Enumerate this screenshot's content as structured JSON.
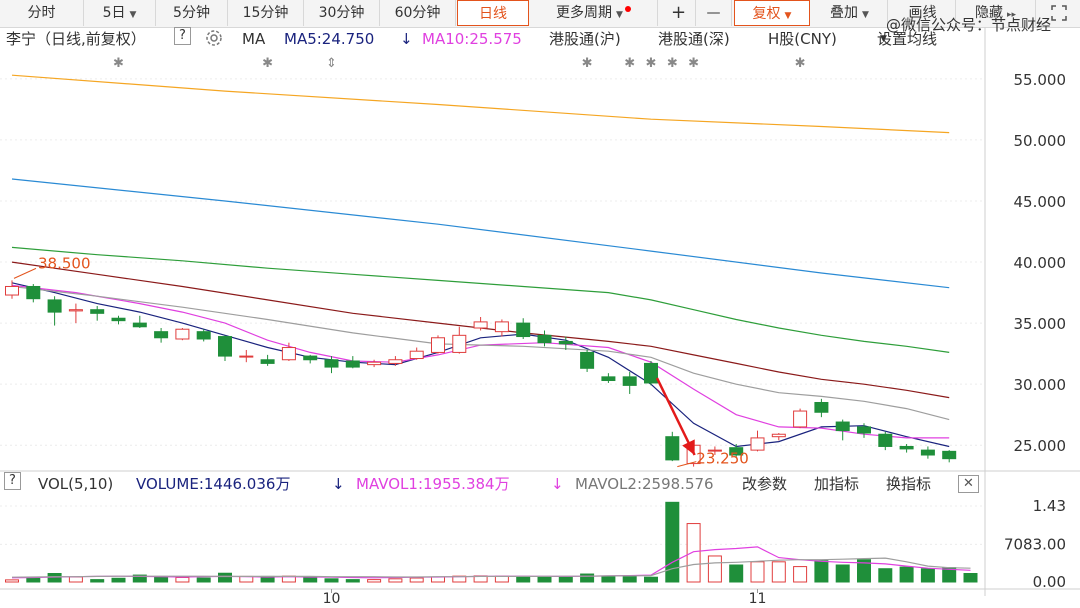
{
  "toolbar": {
    "items": [
      "分时",
      "5日",
      "5分钟",
      "15分钟",
      "30分钟",
      "60分钟",
      "日线",
      "更多周期",
      "+",
      "—",
      "复权",
      "叠加",
      "画线",
      "隐藏"
    ],
    "active": "日线"
  },
  "watermark": "@微信公众号：节点财经",
  "legend": {
    "name": "李宁（日线,前复权）",
    "help": "?",
    "ma_label": "MA",
    "ma5": "MA5:24.750",
    "ma5_arrow": "↓",
    "ma10": "MA10:25.575",
    "hk1": "港股通(沪)",
    "hk2": "港股通(深)",
    "hshare": "H股(CNY)",
    "settings": "设置均线"
  },
  "volume_legend": {
    "help": "?",
    "vol": "VOL(5,10)",
    "volume": "VOLUME:1446.036万",
    "volume_arrow": "↓",
    "mavol1": "MAVOL1:1955.384万",
    "mavol1_arrow": "↓",
    "mavol2": "MAVOL2:2598.576",
    "change_params": "改参数",
    "add_indicator": "加指标",
    "switch_indicator": "换指标",
    "close": "✕"
  },
  "colors": {
    "up": "#e03c3c",
    "down": "#1f8f3a",
    "ma5": "#1a237e",
    "ma10": "#e040e0",
    "ma20": "#9e9e9e",
    "ma30": "#8b1a1a",
    "ma60": "#2e9e3a",
    "ma120": "#2a8ad4",
    "ma250": "#f5a623",
    "highlight": "#e3541d",
    "arrow": "#e31a1a"
  },
  "chart_data": {
    "type": "candlestick",
    "y_axis": {
      "ticks": [
        25,
        30,
        35,
        40,
        45,
        50,
        55
      ],
      "tick_labels": [
        "25.000",
        "30.000",
        "35.000",
        "40.000",
        "45.000",
        "50.000",
        "55.000"
      ],
      "range": [
        23.3,
        57.2
      ]
    },
    "x_axis": {
      "labels": [
        {
          "text": "10",
          "index": 15
        },
        {
          "text": "11",
          "index": 35
        }
      ]
    },
    "annotations": [
      {
        "text": "38.500",
        "index": 0,
        "value": 38.5
      },
      {
        "text": "23.250",
        "index": 31,
        "value": 23.25
      }
    ],
    "event_markers": [
      {
        "index": 5,
        "symbol": "✱"
      },
      {
        "index": 12,
        "symbol": "✱"
      },
      {
        "index": 15,
        "symbol": "⇕"
      },
      {
        "index": 27,
        "symbol": "✱"
      },
      {
        "index": 29,
        "symbol": "✱"
      },
      {
        "index": 30,
        "symbol": "✱"
      },
      {
        "index": 31,
        "symbol": "✱"
      },
      {
        "index": 32,
        "symbol": "✱"
      },
      {
        "index": 37,
        "symbol": "✱"
      }
    ],
    "candles": [
      {
        "o": 37.3,
        "h": 38.5,
        "c": 38.0,
        "l": 37.0
      },
      {
        "o": 38.0,
        "h": 38.2,
        "c": 37.0,
        "l": 36.7
      },
      {
        "o": 36.9,
        "h": 37.2,
        "c": 35.9,
        "l": 34.8
      },
      {
        "o": 36.0,
        "h": 36.6,
        "c": 36.1,
        "l": 35.0
      },
      {
        "o": 36.1,
        "h": 36.4,
        "c": 35.8,
        "l": 35.2
      },
      {
        "o": 35.4,
        "h": 35.6,
        "c": 35.2,
        "l": 34.9
      },
      {
        "o": 35.0,
        "h": 35.6,
        "c": 34.7,
        "l": 34.6
      },
      {
        "o": 34.3,
        "h": 34.6,
        "c": 33.8,
        "l": 33.4
      },
      {
        "o": 33.7,
        "h": 34.6,
        "c": 34.5,
        "l": 33.6
      },
      {
        "o": 34.3,
        "h": 34.5,
        "c": 33.7,
        "l": 33.5
      },
      {
        "o": 33.9,
        "h": 34.0,
        "c": 32.3,
        "l": 31.9
      },
      {
        "o": 32.3,
        "h": 32.8,
        "c": 32.3,
        "l": 31.8
      },
      {
        "o": 32.0,
        "h": 32.4,
        "c": 31.7,
        "l": 31.5
      },
      {
        "o": 32.0,
        "h": 33.4,
        "c": 33.0,
        "l": 31.9
      },
      {
        "o": 32.3,
        "h": 32.4,
        "c": 32.0,
        "l": 31.7
      },
      {
        "o": 32.0,
        "h": 32.3,
        "c": 31.4,
        "l": 30.9
      },
      {
        "o": 31.9,
        "h": 32.3,
        "c": 31.4,
        "l": 31.3
      },
      {
        "o": 31.6,
        "h": 32.0,
        "c": 31.8,
        "l": 31.4
      },
      {
        "o": 31.7,
        "h": 32.3,
        "c": 32.0,
        "l": 31.5
      },
      {
        "o": 32.1,
        "h": 33.0,
        "c": 32.7,
        "l": 32.0
      },
      {
        "o": 32.6,
        "h": 34.0,
        "c": 33.8,
        "l": 32.5
      },
      {
        "o": 32.6,
        "h": 34.7,
        "c": 34.0,
        "l": 32.5
      },
      {
        "o": 34.6,
        "h": 35.5,
        "c": 35.1,
        "l": 34.4
      },
      {
        "o": 34.3,
        "h": 35.3,
        "c": 35.1,
        "l": 33.9
      },
      {
        "o": 35.0,
        "h": 35.4,
        "c": 33.9,
        "l": 33.7
      },
      {
        "o": 34.0,
        "h": 34.4,
        "c": 33.4,
        "l": 33.1
      },
      {
        "o": 33.5,
        "h": 33.9,
        "c": 33.3,
        "l": 32.8
      },
      {
        "o": 32.6,
        "h": 32.8,
        "c": 31.3,
        "l": 31.0
      },
      {
        "o": 30.6,
        "h": 30.9,
        "c": 30.3,
        "l": 30.1
      },
      {
        "o": 30.6,
        "h": 31.0,
        "c": 29.9,
        "l": 29.2
      },
      {
        "o": 31.7,
        "h": 31.9,
        "c": 30.1,
        "l": 29.9
      },
      {
        "o": 25.7,
        "h": 26.1,
        "c": 23.8,
        "l": 23.7
      },
      {
        "o": 23.5,
        "h": 25.1,
        "c": 25.0,
        "l": 23.25
      },
      {
        "o": 24.6,
        "h": 24.9,
        "c": 24.6,
        "l": 24.2
      },
      {
        "o": 24.8,
        "h": 25.1,
        "c": 24.2,
        "l": 24.0
      },
      {
        "o": 24.6,
        "h": 26.2,
        "c": 25.6,
        "l": 24.5
      },
      {
        "o": 25.7,
        "h": 26.0,
        "c": 25.9,
        "l": 25.4
      },
      {
        "o": 26.5,
        "h": 28.0,
        "c": 27.8,
        "l": 26.4
      },
      {
        "o": 28.5,
        "h": 28.8,
        "c": 27.7,
        "l": 27.3
      },
      {
        "o": 26.9,
        "h": 27.1,
        "c": 26.2,
        "l": 25.4
      },
      {
        "o": 26.5,
        "h": 26.8,
        "c": 26.0,
        "l": 25.6
      },
      {
        "o": 25.9,
        "h": 26.1,
        "c": 24.9,
        "l": 24.6
      },
      {
        "o": 24.9,
        "h": 25.1,
        "c": 24.7,
        "l": 24.4
      },
      {
        "o": 24.6,
        "h": 24.9,
        "c": 24.2,
        "l": 23.9
      },
      {
        "o": 24.5,
        "h": 24.6,
        "c": 23.9,
        "l": 23.6
      }
    ],
    "moving_averages": [
      {
        "name": "MA5",
        "points": [
          [
            0,
            38.3
          ],
          [
            2,
            37.5
          ],
          [
            4,
            36.6
          ],
          [
            6,
            35.9
          ],
          [
            8,
            35.0
          ],
          [
            10,
            34.0
          ],
          [
            12,
            33.0
          ],
          [
            14,
            32.2
          ],
          [
            16,
            31.8
          ],
          [
            18,
            31.6
          ],
          [
            20,
            32.6
          ],
          [
            22,
            33.8
          ],
          [
            24,
            34.1
          ],
          [
            26,
            33.6
          ],
          [
            28,
            32.2
          ],
          [
            30,
            30.0
          ],
          [
            32,
            26.8
          ],
          [
            34,
            24.9
          ],
          [
            36,
            25.3
          ],
          [
            38,
            26.5
          ],
          [
            40,
            26.6
          ],
          [
            42,
            25.7
          ],
          [
            44,
            24.9
          ]
        ]
      },
      {
        "name": "MA10",
        "points": [
          [
            0,
            38.1
          ],
          [
            3,
            37.5
          ],
          [
            6,
            36.6
          ],
          [
            8,
            35.9
          ],
          [
            10,
            35.0
          ],
          [
            12,
            33.6
          ],
          [
            14,
            32.6
          ],
          [
            16,
            31.9
          ],
          [
            18,
            31.8
          ],
          [
            20,
            32.4
          ],
          [
            22,
            33.2
          ],
          [
            25,
            33.4
          ],
          [
            28,
            33.0
          ],
          [
            30,
            31.8
          ],
          [
            32,
            29.6
          ],
          [
            34,
            27.5
          ],
          [
            36,
            26.5
          ],
          [
            38,
            26.4
          ],
          [
            40,
            25.9
          ],
          [
            42,
            25.6
          ],
          [
            44,
            25.6
          ]
        ]
      },
      {
        "name": "MA20",
        "points": [
          [
            0,
            38.0
          ],
          [
            4,
            37.2
          ],
          [
            8,
            36.3
          ],
          [
            12,
            35.3
          ],
          [
            16,
            34.2
          ],
          [
            20,
            33.3
          ],
          [
            24,
            33.1
          ],
          [
            28,
            32.7
          ],
          [
            30,
            32.2
          ],
          [
            32,
            30.9
          ],
          [
            34,
            30.0
          ],
          [
            36,
            29.3
          ],
          [
            38,
            29.0
          ],
          [
            40,
            28.6
          ],
          [
            42,
            28.0
          ],
          [
            44,
            27.1
          ]
        ]
      },
      {
        "name": "MA30",
        "points": [
          [
            0,
            40.0
          ],
          [
            4,
            39.0
          ],
          [
            8,
            38.0
          ],
          [
            12,
            36.9
          ],
          [
            16,
            35.8
          ],
          [
            20,
            35.0
          ],
          [
            24,
            34.2
          ],
          [
            28,
            33.5
          ],
          [
            30,
            33.1
          ],
          [
            32,
            32.4
          ],
          [
            34,
            31.7
          ],
          [
            36,
            31.0
          ],
          [
            38,
            30.4
          ],
          [
            40,
            30.0
          ],
          [
            42,
            29.5
          ],
          [
            44,
            28.9
          ]
        ]
      },
      {
        "name": "MA60",
        "points": [
          [
            0,
            41.2
          ],
          [
            4,
            40.6
          ],
          [
            8,
            40.1
          ],
          [
            12,
            39.5
          ],
          [
            16,
            39.0
          ],
          [
            20,
            38.5
          ],
          [
            24,
            38.0
          ],
          [
            28,
            37.5
          ],
          [
            30,
            36.9
          ],
          [
            32,
            36.1
          ],
          [
            34,
            35.3
          ],
          [
            36,
            34.6
          ],
          [
            38,
            34.0
          ],
          [
            40,
            33.5
          ],
          [
            42,
            33.1
          ],
          [
            44,
            32.6
          ]
        ]
      },
      {
        "name": "MA120",
        "points": [
          [
            0,
            46.8
          ],
          [
            10,
            45.0
          ],
          [
            20,
            43.1
          ],
          [
            30,
            40.9
          ],
          [
            38,
            39.1
          ],
          [
            44,
            37.9
          ]
        ]
      },
      {
        "name": "MA250",
        "points": [
          [
            0,
            55.3
          ],
          [
            10,
            54.0
          ],
          [
            20,
            52.9
          ],
          [
            30,
            51.7
          ],
          [
            38,
            51.1
          ],
          [
            44,
            50.6
          ]
        ]
      }
    ],
    "volume": {
      "y_tick_labels": [
        "1.43",
        "7083.00",
        "0.00"
      ],
      "y_ticks": [
        14300,
        7083,
        0
      ],
      "y_range": [
        0,
        16000
      ],
      "bars": [
        400,
        700,
        1600,
        950,
        450,
        700,
        1300,
        1050,
        850,
        750,
        1650,
        1050,
        1050,
        1100,
        750,
        600,
        450,
        450,
        600,
        750,
        950,
        1100,
        1150,
        1100,
        1050,
        1050,
        1000,
        1500,
        1000,
        1150,
        900,
        15000,
        11000,
        4900,
        3200,
        3800,
        3800,
        2900,
        4000,
        3200,
        4200,
        2500,
        2800,
        2500,
        2700,
        1600
      ],
      "mavol1": [
        800,
        850,
        950,
        1000,
        1050,
        1100,
        1050,
        1000,
        950,
        1000,
        1050,
        1000,
        950,
        1000,
        950,
        900,
        850,
        800,
        850,
        900,
        950,
        1000,
        1050,
        1100,
        1100,
        1050,
        1050,
        1100,
        1150,
        1200,
        1300,
        3700,
        5700,
        6100,
        6300,
        6600,
        4600,
        4200,
        3900,
        3700,
        3600,
        3400,
        3000,
        2600,
        2400,
        2200
      ],
      "mavol2": [
        900,
        950,
        1000,
        1000,
        1050,
        1100,
        1100,
        1100,
        1100,
        1100,
        1050,
        1050,
        1050,
        1050,
        1050,
        1000,
        1000,
        1000,
        950,
        950,
        1000,
        1000,
        1050,
        1050,
        1050,
        1050,
        1100,
        1100,
        1150,
        1150,
        1200,
        2500,
        3300,
        3600,
        3700,
        3900,
        4100,
        4200,
        4200,
        4300,
        4400,
        4500,
        3800,
        3000,
        2700,
        2600
      ]
    }
  }
}
